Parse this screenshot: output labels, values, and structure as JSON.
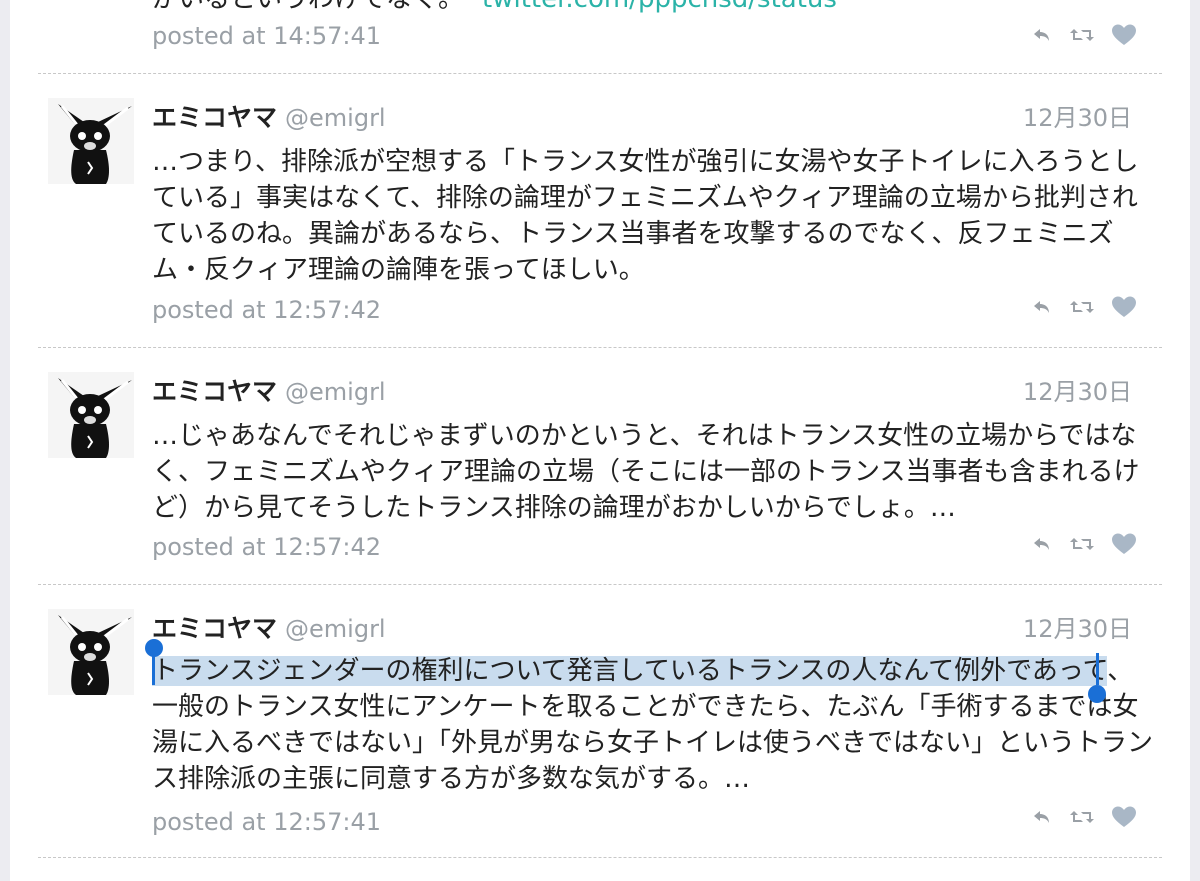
{
  "top_partial": {
    "text": "がいるというわけでなく。",
    "link": "twitter.com/pppcnsd/status",
    "posted": "posted at 14:57:41"
  },
  "tweets": [
    {
      "name": "エミコヤマ",
      "handle": "@emigrl",
      "date": "12月30日",
      "lines": [
        "…つまり、排除派が空想する「トランス女性が強引に女湯や女子トイレに入ろうとし",
        "ている」事実はなくて、排除の論理がフェミニズムやクィア理論の立場から批判され",
        "ているのね。異論があるなら、トランス当事者を攻撃するのでなく、反フェミニズ",
        "ム・反クィア理論の論陣を張ってほしい。"
      ],
      "posted": "posted at 12:57:42"
    },
    {
      "name": "エミコヤマ",
      "handle": "@emigrl",
      "date": "12月30日",
      "lines": [
        "…じゃあなんでそれじゃまずいのかというと、それはトランス女性の立場からではな",
        "く、フェミニズムやクィア理論の立場（そこには一部のトランス当事者も含まれるけ",
        "ど）から見てそうしたトランス排除の論理がおかしいからでしょ。…"
      ],
      "posted": "posted at 12:57:42"
    },
    {
      "name": "エミコヤマ",
      "handle": "@emigrl",
      "date": "12月30日",
      "selected_line": "トランスジェンダーの権利について発言しているトランスの人なんて例外であって",
      "after_selected": "、",
      "lines": [
        "一般のトランス女性にアンケートを取ることができたら、たぶん「手術するまでは女",
        "湯に入るべきではない」「外見が男なら女子トイレは使うべきではない」というトラン",
        "ス排除派の主張に同意する方が多数な気がする。…"
      ],
      "posted": "posted at 12:57:41"
    }
  ],
  "icons": [
    "reply-icon",
    "retweet-icon",
    "like-icon"
  ],
  "colors": {
    "meta": "#9aa0a6",
    "link": "#2bb3a8",
    "selection": "#c9dcee",
    "selection_handle": "#1a6fd6",
    "icon": "#9aa0a6",
    "like": "#a9b7c6"
  }
}
